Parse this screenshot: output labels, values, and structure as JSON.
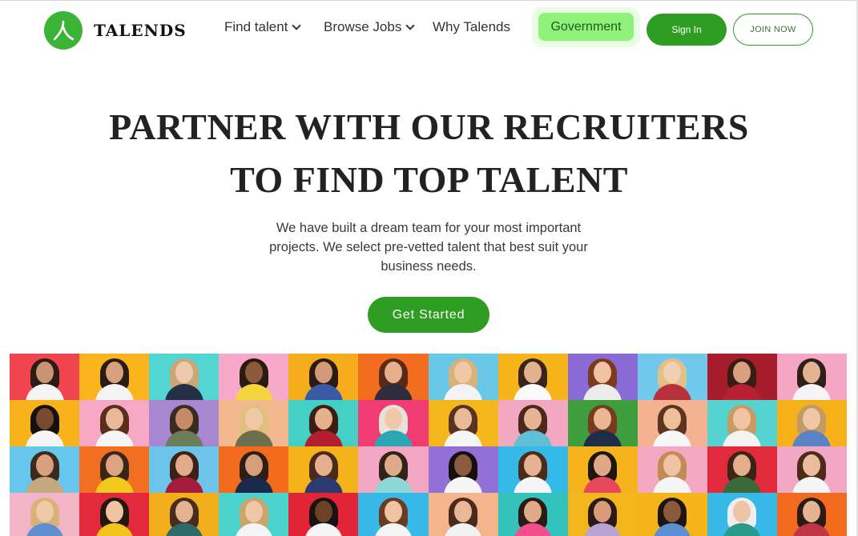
{
  "brand": {
    "name": "Talends",
    "logo_color": "#3bb336"
  },
  "nav": {
    "find_talent": "Find talent",
    "browse_jobs": "Browse Jobs",
    "why": "Why Talends",
    "government": "Government",
    "sign_in": "Sign In",
    "join_now": "JOIN NOW"
  },
  "hero": {
    "title_line1": "PARTNER WITH OUR RECRUITERS",
    "title_line2": "TO FIND TOP TALENT",
    "subtitle": "We have built a dream team for your most important projects. We select pre-vetted talent that best suit your business needs.",
    "cta": "Get Started"
  },
  "colors": {
    "accent": "#2e9e22",
    "government_bg": "#8ff07a"
  },
  "mosaic": [
    {
      "bg": "#f0454e",
      "hair": "#2b1d16",
      "skin": "#c99273",
      "shirt": "#f5f5f5"
    },
    {
      "bg": "#fbb41c",
      "hair": "#2a1b14",
      "skin": "#d9a07e",
      "shirt": "#f4f4f4"
    },
    {
      "bg": "#53d6d2",
      "hair": "#c9a777",
      "skin": "#efc9ae",
      "shirt": "#243045"
    },
    {
      "bg": "#f8a9c9",
      "hair": "#2b1a10",
      "skin": "#8a5a3c",
      "shirt": "#f5d53e"
    },
    {
      "bg": "#f6ad1b",
      "hair": "#2b1b12",
      "skin": "#d29a78",
      "shirt": "#3b5aa6"
    },
    {
      "bg": "#f26d1f",
      "hair": "#5a2a17",
      "skin": "#e6b08e",
      "shirt": "#2d2d3d"
    },
    {
      "bg": "#69c8e8",
      "hair": "#d9b27a",
      "skin": "#f0c8a8",
      "shirt": "#f3f3f3"
    },
    {
      "bg": "#f6b41b",
      "hair": "#3a2418",
      "skin": "#e2b18e",
      "shirt": "#fafafa"
    },
    {
      "bg": "#8a6ad4",
      "hair": "#7c3a1e",
      "skin": "#efc2a1",
      "shirt": "#ececec"
    },
    {
      "bg": "#70c9ea",
      "hair": "#e1c187",
      "skin": "#f2cfb3",
      "shirt": "#b8303b"
    },
    {
      "bg": "#a61c2b",
      "hair": "#3a1d12",
      "skin": "#d99f80",
      "shirt": "#b52032"
    },
    {
      "bg": "#f6a5c5",
      "hair": "#2e2017",
      "skin": "#e4b393",
      "shirt": "#f5f5f5"
    },
    {
      "bg": "#f7b21c",
      "hair": "#17110d",
      "skin": "#7a4a2e",
      "shirt": "#f5f5f5"
    },
    {
      "bg": "#f7a8c4",
      "hair": "#5a2e1b",
      "skin": "#eab899",
      "shirt": "#f5f5f5"
    },
    {
      "bg": "#a887d1",
      "hair": "#3a2a22",
      "skin": "#c58a66",
      "shirt": "#6b7d5b"
    },
    {
      "bg": "#f2b98f",
      "hair": "#e0c07e",
      "skin": "#f2c9a7",
      "shirt": "#6b6f4d"
    },
    {
      "bg": "#44d0c4",
      "hair": "#3c1f14",
      "skin": "#e5b08c",
      "shirt": "#b41c2f"
    },
    {
      "bg": "#f03b73",
      "hair": "#e8e2d8",
      "skin": "#f0c7a9",
      "shirt": "#2aa7b2"
    },
    {
      "bg": "#f5b71c",
      "hair": "#5b3421",
      "skin": "#e9bb96",
      "shirt": "#f5f5f5"
    },
    {
      "bg": "#f2a8c0",
      "hair": "#4b2a1c",
      "skin": "#e6b493",
      "shirt": "#60bfd4"
    },
    {
      "bg": "#3e9d3c",
      "hair": "#7a3a1f",
      "skin": "#eab694",
      "shirt": "#1f2c4a"
    },
    {
      "bg": "#f4b390",
      "hair": "#5e3421",
      "skin": "#efbf9c",
      "shirt": "#f7f7f7"
    },
    {
      "bg": "#54d3d0",
      "hair": "#c89b64",
      "skin": "#f0c4a4",
      "shirt": "#f3f3f3"
    },
    {
      "bg": "#f6b01a",
      "hair": "#c29a63",
      "skin": "#f1c7a6",
      "shirt": "#5a82c4"
    },
    {
      "bg": "#66c6ec",
      "hair": "#3c2a1e",
      "skin": "#d9a07f",
      "shirt": "#c3a97d"
    },
    {
      "bg": "#f26e20",
      "hair": "#3b2418",
      "skin": "#dea382",
      "shirt": "#f3c91e"
    },
    {
      "bg": "#6cc4eb",
      "hair": "#3b2117",
      "skin": "#e1ab8a",
      "shirt": "#a31d3a"
    },
    {
      "bg": "#f26b1c",
      "hair": "#2c1d15",
      "skin": "#d89d7c",
      "shirt": "#1b2a4a"
    },
    {
      "bg": "#f4b21b",
      "hair": "#4a2a1a",
      "skin": "#e5b08f",
      "shirt": "#2c3a70"
    },
    {
      "bg": "#f2a6c3",
      "hair": "#332218",
      "skin": "#ddaa8a",
      "shirt": "#8fd6d8"
    },
    {
      "bg": "#9370d6",
      "hair": "#160f0b",
      "skin": "#8a5b3f",
      "shirt": "#f5f5f5"
    },
    {
      "bg": "#35b9e6",
      "hair": "#4a2b1c",
      "skin": "#e6b291",
      "shirt": "#f5f5f5"
    },
    {
      "bg": "#f6b31b",
      "hair": "#1f1510",
      "skin": "#dfa884",
      "shirt": "#e8495a"
    },
    {
      "bg": "#f5a8c2",
      "hair": "#c28a55",
      "skin": "#efc3a3",
      "shirt": "#f5f5f5"
    },
    {
      "bg": "#e12b3c",
      "hair": "#3a2418",
      "skin": "#e4ad8c",
      "shirt": "#3a6a3c"
    },
    {
      "bg": "#f2a7c2",
      "hair": "#4d2a1a",
      "skin": "#ebbc9c",
      "shirt": "#f5f5f5"
    },
    {
      "bg": "#f4b4c8",
      "hair": "#d7b37a",
      "skin": "#f1c8a8",
      "shirt": "#5e8fcf"
    },
    {
      "bg": "#e32a3c",
      "hair": "#241710",
      "skin": "#efc2a2",
      "shirt": "#f3c41c"
    },
    {
      "bg": "#f3ae1b",
      "hair": "#4a2c1c",
      "skin": "#e6b391",
      "shirt": "#2d6b6b"
    },
    {
      "bg": "#4dd3ce",
      "hair": "#caa469",
      "skin": "#f0c7a6",
      "shirt": "#f5f5f5"
    },
    {
      "bg": "#e22438",
      "hair": "#1a120e",
      "skin": "#6b4128",
      "shirt": "#f5f5f5"
    },
    {
      "bg": "#38b8e6",
      "hair": "#6a3b22",
      "skin": "#efc2a1",
      "shirt": "#f5f5f5"
    },
    {
      "bg": "#f4b48c",
      "hair": "#4a2a1b",
      "skin": "#e9b897",
      "shirt": "#f2f2f2"
    },
    {
      "bg": "#34c3bc",
      "hair": "#2a1b14",
      "skin": "#e0aa88",
      "shirt": "#f24e8d"
    },
    {
      "bg": "#f4b61d",
      "hair": "#2a1b14",
      "skin": "#d89c7b",
      "shirt": "#b9a3d6"
    },
    {
      "bg": "#f5b41c",
      "hair": "#1f140f",
      "skin": "#8b5a3c",
      "shirt": "#5b8fd4"
    },
    {
      "bg": "#36b9e6",
      "hair": "#eeeeee",
      "skin": "#efc3a6",
      "shirt": "#2a9a8c"
    },
    {
      "bg": "#f26a1e",
      "hair": "#2a1b14",
      "skin": "#e6b294",
      "shirt": "#c03448"
    }
  ]
}
